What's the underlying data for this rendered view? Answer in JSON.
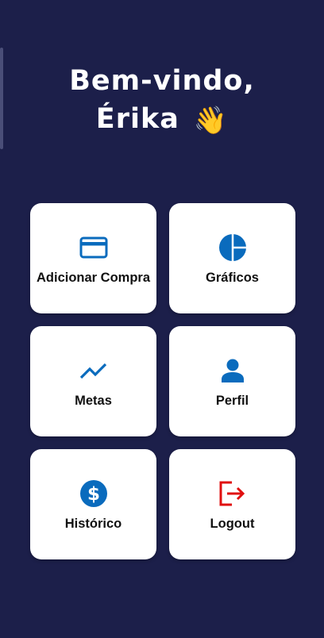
{
  "greeting": {
    "line1": "Bem-vindo,",
    "line2": "Érika",
    "emoji": "👋"
  },
  "menu": [
    {
      "label": "Adicionar Compra",
      "icon": "credit-card-icon"
    },
    {
      "label": "Gráficos",
      "icon": "pie-chart-icon"
    },
    {
      "label": "Metas",
      "icon": "trending-up-icon"
    },
    {
      "label": "Perfil",
      "icon": "person-icon"
    },
    {
      "label": "Histórico",
      "icon": "dollar-circle-icon"
    },
    {
      "label": "Logout",
      "icon": "logout-icon"
    }
  ],
  "colors": {
    "background": "#1c1f4a",
    "icon_primary": "#0a6bbd",
    "icon_logout": "#e01010",
    "card": "#ffffff"
  }
}
